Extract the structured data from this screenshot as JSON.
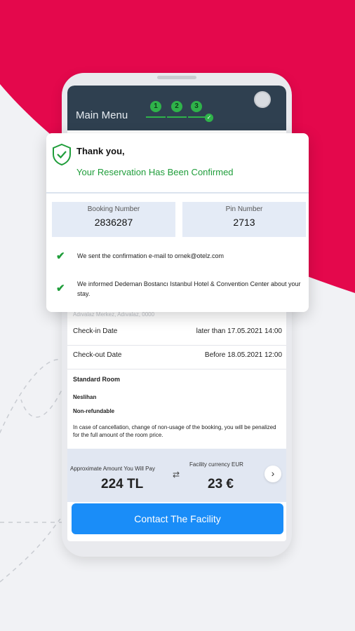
{
  "colors": {
    "accent": "#e4084c",
    "success": "#1f9d3a",
    "primary_button": "#1a8df8",
    "header": "#2f4050"
  },
  "phone": {
    "menu_title": "Main Menu",
    "steps": [
      "1",
      "2",
      "3"
    ],
    "address_muted": "Adıvalaz Merkez, Adıvalaz, 0000",
    "checkin": {
      "label": "Check-in Date",
      "value": "later than 17.05.2021 14:00"
    },
    "checkout": {
      "label": "Check-out Date",
      "value": "Before 18.05.2021 12:00"
    },
    "room": {
      "type": "Standard Room",
      "guest": "Neslihan",
      "policy": "Non-refundable",
      "cancellation": "In case of cancellation, change of non-usage of the booking, you will be penalized for the full amount of the room price."
    },
    "price": {
      "approx_label": "Approximate Amount You Will Pay",
      "approx_value": "224 TL",
      "currency_label": "Facility currency EUR",
      "currency_value": "23 €",
      "swap_icon": "swap-icon",
      "next_icon": "chevron-right-icon"
    },
    "contact_button": "Contact The Facility"
  },
  "card": {
    "icon": "shield-check-icon",
    "thanks": "Thank you,",
    "confirmed": "Your Reservation Has Been Confirmed",
    "booking_label": "Booking Number",
    "booking_value": "2836287",
    "pin_label": "Pin Number",
    "pin_value": "2713",
    "messages": [
      "We sent the confirmation e-mail to ornek@otelz.com",
      "We informed Dedeman Bostancı Istanbul Hotel & Convention Center about your stay."
    ]
  }
}
